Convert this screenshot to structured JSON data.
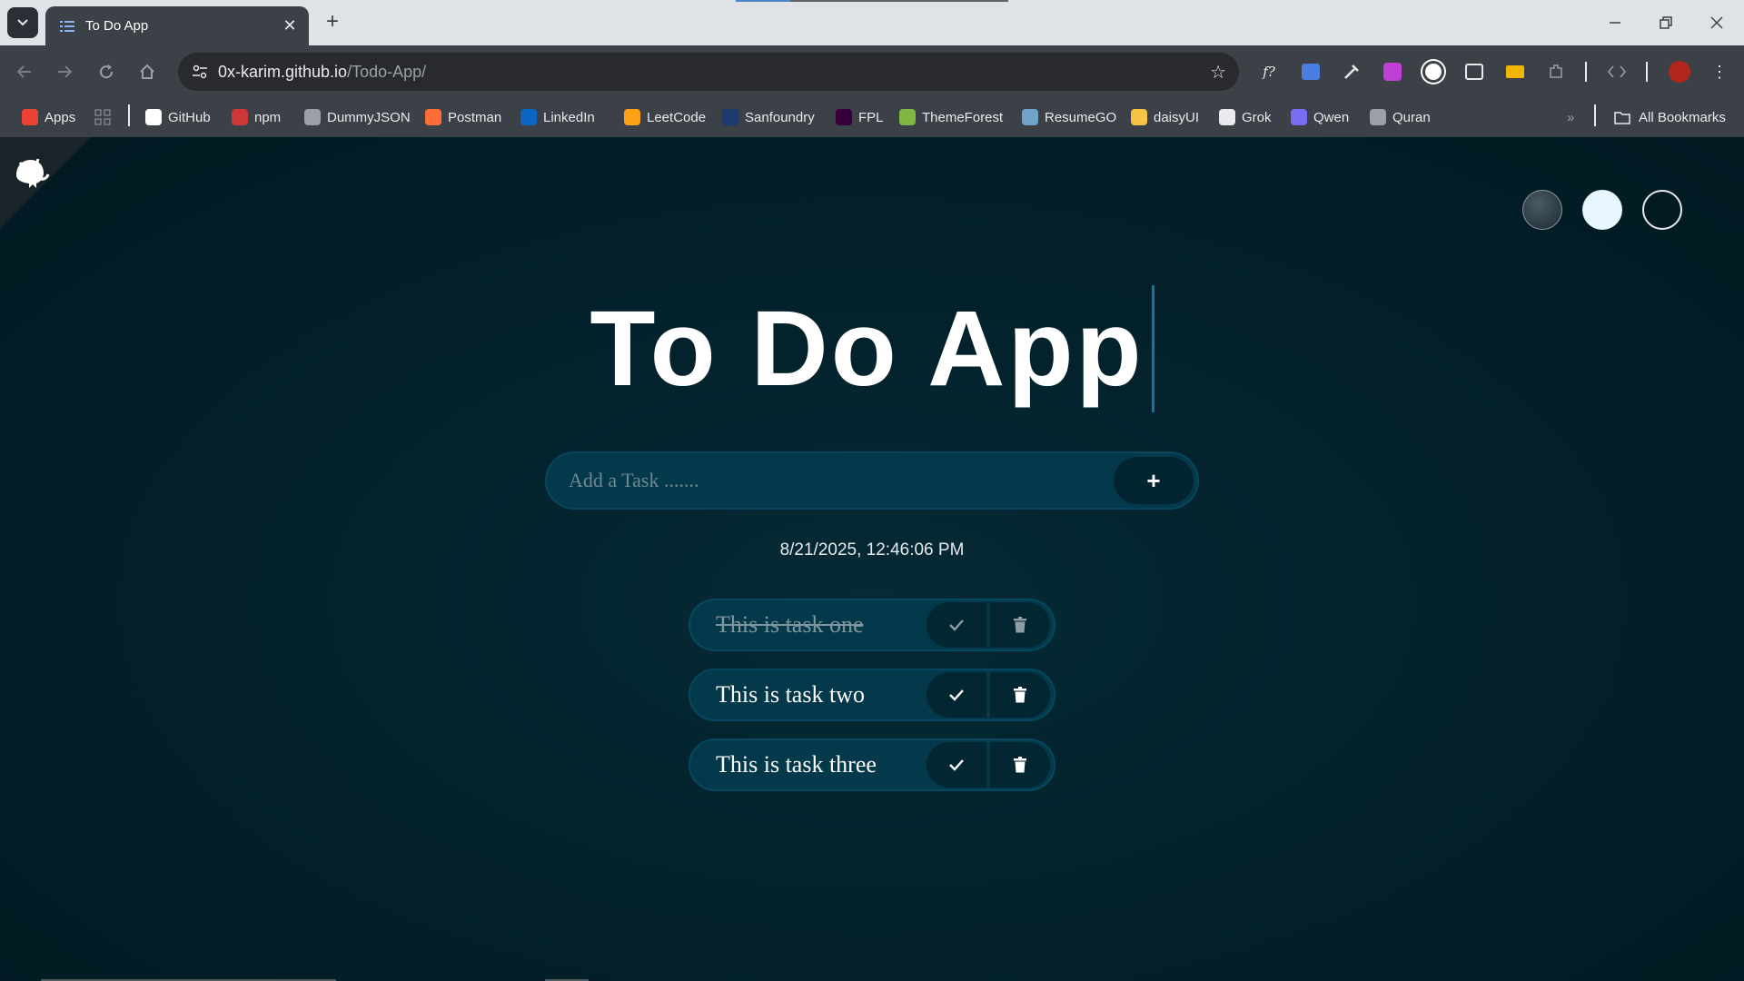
{
  "browser": {
    "tab_title": "To Do App",
    "url_host": "0x-karim.github.io",
    "url_path": "/Todo-App/",
    "bookmarks": [
      {
        "label": "Apps",
        "icon": "apps-grid-icon",
        "color": "#ea4335"
      },
      {
        "label": "GitHub",
        "icon": "github-icon",
        "color": "#ffffff"
      },
      {
        "label": "npm",
        "icon": "npm-icon",
        "color": "#cb3837"
      },
      {
        "label": "DummyJSON",
        "icon": "dummyjson-icon",
        "color": "#9aa0a6"
      },
      {
        "label": "Postman",
        "icon": "postman-icon",
        "color": "#ff6c37"
      },
      {
        "label": "LinkedIn",
        "icon": "linkedin-icon",
        "color": "#0a66c2"
      },
      {
        "label": "LeetCode",
        "icon": "leetcode-icon",
        "color": "#ffa116"
      },
      {
        "label": "Sanfoundry",
        "icon": "sanfoundry-icon",
        "color": "#1d3b6e"
      },
      {
        "label": "FPL",
        "icon": "fpl-icon",
        "color": "#37003c"
      },
      {
        "label": "ThemeForest",
        "icon": "themeforest-icon",
        "color": "#82b541"
      },
      {
        "label": "ResumeGO",
        "icon": "resumego-icon",
        "color": "#6fa3c7"
      },
      {
        "label": "daisyUI",
        "icon": "daisyui-icon",
        "color": "#f5c445"
      },
      {
        "label": "Grok",
        "icon": "grok-icon",
        "color": "#e8eaed"
      },
      {
        "label": "Qwen",
        "icon": "qwen-icon",
        "color": "#7a6cf0"
      },
      {
        "label": "Quran",
        "icon": "quran-icon",
        "color": "#9aa0a6"
      }
    ],
    "all_bookmarks": "All Bookmarks"
  },
  "app": {
    "title": "To Do App",
    "input_placeholder": "Add a Task .......",
    "add_label": "+",
    "datetime": "8/21/2025, 12:46:06 PM",
    "tasks": [
      {
        "text": "This is task one",
        "done": true
      },
      {
        "text": "This is task two",
        "done": false
      },
      {
        "text": "This is task three",
        "done": false
      }
    ],
    "theme_colors": [
      "#2c3e45",
      "#e8f7ff",
      "#021a22"
    ]
  }
}
